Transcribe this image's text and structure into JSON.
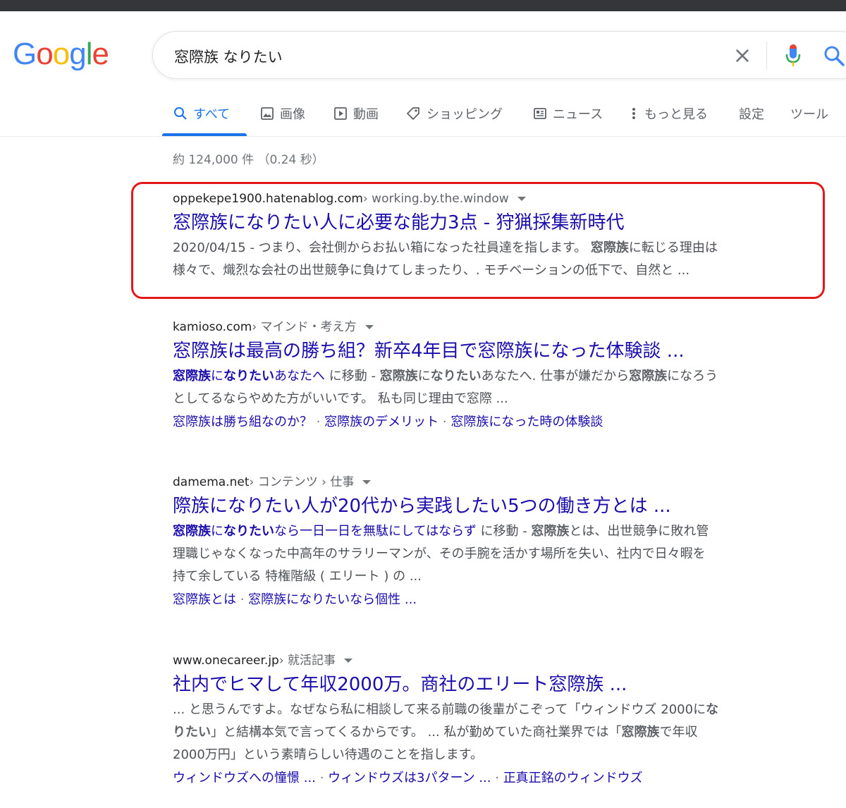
{
  "logo": {
    "text": "Google"
  },
  "search": {
    "query": "窓際族 なりたい"
  },
  "tabs": [
    {
      "label": "すべて"
    },
    {
      "label": "画像"
    },
    {
      "label": "動画"
    },
    {
      "label": "ショッピング"
    },
    {
      "label": "ニュース"
    },
    {
      "label": "もっと見る"
    },
    {
      "label": "設定"
    },
    {
      "label": "ツール"
    }
  ],
  "stats": "約 124,000 件 （0.24 秒）",
  "results": [
    {
      "domain": "oppekepe1900.hatenablog.com",
      "path": " › working.by.the.window",
      "title": "窓際族になりたい人に必要な能力3点 - 狩猟採集新時代",
      "snippet": [
        "2020/04/15 - つまり、会社側からお払い箱になった社員達を指します。",
        "窓際族",
        "に転じる理由は",
        "様々で、熾烈な会社の出世競争に負けてしまったり、. モチベーションの低下で、自然と ..."
      ]
    },
    {
      "domain": "kamioso.com",
      "path": " › マインド・考え方",
      "title": "窓際族は最高の勝ち組？新卒4年目で窓際族になった体験談 ...",
      "snippet": [
        "窓際族",
        "に",
        "なりたい",
        "あなたへ",
        " に移動 - ",
        "窓際族",
        "に",
        "なりたい",
        "あなたへ. 仕事が嫌だから",
        "窓際族",
        "になろう",
        "としてるならやめた方がいいです。 私も同じ理由で窓際 ..."
      ],
      "sitelinks": [
        "窓際族は勝ち組なのか？",
        "窓際族のデメリット",
        "窓際族になった時の体験談"
      ]
    },
    {
      "domain": "damema.net",
      "path": " › コンテンツ › 仕事",
      "title": "際族になりたい人が20代から実践したい5つの働き方とは ...",
      "snippet": [
        "窓際族",
        "に",
        "なりたい",
        "なら一日一日を無駄にしてはならず",
        " に移動 - ",
        "窓際族",
        "とは、出世競争に敗れ管",
        "理職じゃなくなった中高年のサラリーマンが、その手腕を活かす場所を失い、社内で日々暇を",
        "持て余している 特権階級 ( エリート ) の ..."
      ],
      "sitelinks": [
        "窓際族とは",
        "窓際族になりたいなら個性 ..."
      ]
    },
    {
      "domain": "www.onecareer.jp",
      "path": " › 就活記事",
      "title": "社内でヒマして年収2000万。商社のエリート窓際族 ...",
      "snippet": [
        "... と思うんですよ。なぜなら私に相談して来る前職の後輩がこぞって「ウィンドウズ 2000に",
        "な",
        "りたい",
        "」と結構本気で言ってくるからです。 ... 私が勤めていた商社業界では「",
        "窓際族",
        "で年収",
        "2000万円」という素晴らしい待遇のことを指します。"
      ],
      "sitelinks": [
        "ウィンドウズへの憧憬 ...",
        "ウィンドウズは3パターン ...",
        "正真正銘のウィンドウズ"
      ]
    }
  ],
  "colors": {
    "link": "#1a0dab",
    "accent": "#1a73e8",
    "highlight": "#e2191b"
  }
}
